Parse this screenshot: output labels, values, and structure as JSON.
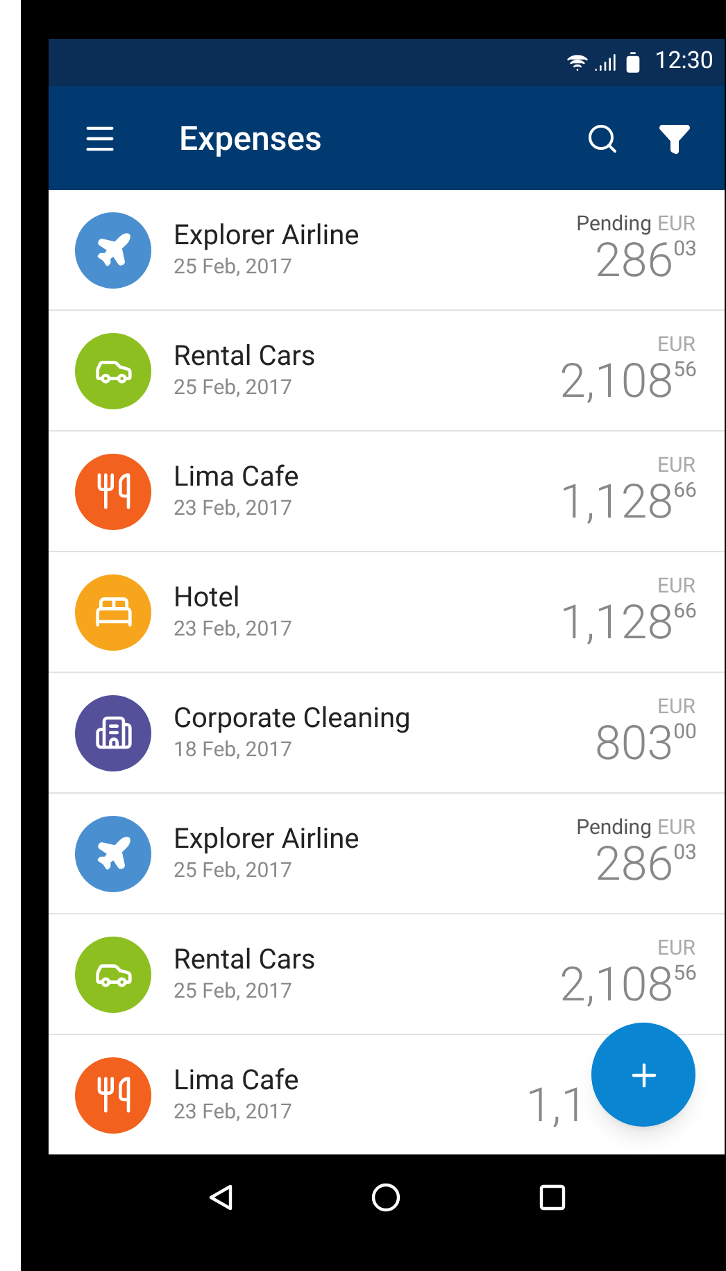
{
  "status_bar": {
    "time": "12:30"
  },
  "app_bar": {
    "title": "Expenses"
  },
  "expenses": [
    {
      "kind": "flight",
      "color": "#4a8fd0",
      "name": "Explorer Airline",
      "date": "25 Feb, 2017",
      "status": "Pending",
      "currency": "EUR",
      "amount": "286",
      "cents": "03"
    },
    {
      "kind": "car",
      "color": "#8cbf1f",
      "name": "Rental Cars",
      "date": "25 Feb, 2017",
      "currency": "EUR",
      "amount": "2,108",
      "cents": "56"
    },
    {
      "kind": "food",
      "color": "#f2611d",
      "name": "Lima Cafe",
      "date": "23 Feb, 2017",
      "currency": "EUR",
      "amount": "1,128",
      "cents": "66"
    },
    {
      "kind": "hotel",
      "color": "#f7a51c",
      "name": "Hotel",
      "date": "23 Feb, 2017",
      "currency": "EUR",
      "amount": "1,128",
      "cents": "66"
    },
    {
      "kind": "building",
      "color": "#54509a",
      "name": "Corporate Cleaning",
      "date": "18 Feb, 2017",
      "currency": "EUR",
      "amount": "803",
      "cents": "00"
    },
    {
      "kind": "flight",
      "color": "#4a8fd0",
      "name": "Explorer Airline",
      "date": "25 Feb, 2017",
      "status": "Pending",
      "currency": "EUR",
      "amount": "286",
      "cents": "03"
    },
    {
      "kind": "car",
      "color": "#8cbf1f",
      "name": "Rental Cars",
      "date": "25 Feb, 2017",
      "currency": "EUR",
      "amount": "2,108",
      "cents": "56"
    },
    {
      "kind": "food",
      "color": "#f2611d",
      "name": "Lima Cafe",
      "date": "23 Feb, 2017",
      "amount": "1,1"
    }
  ]
}
